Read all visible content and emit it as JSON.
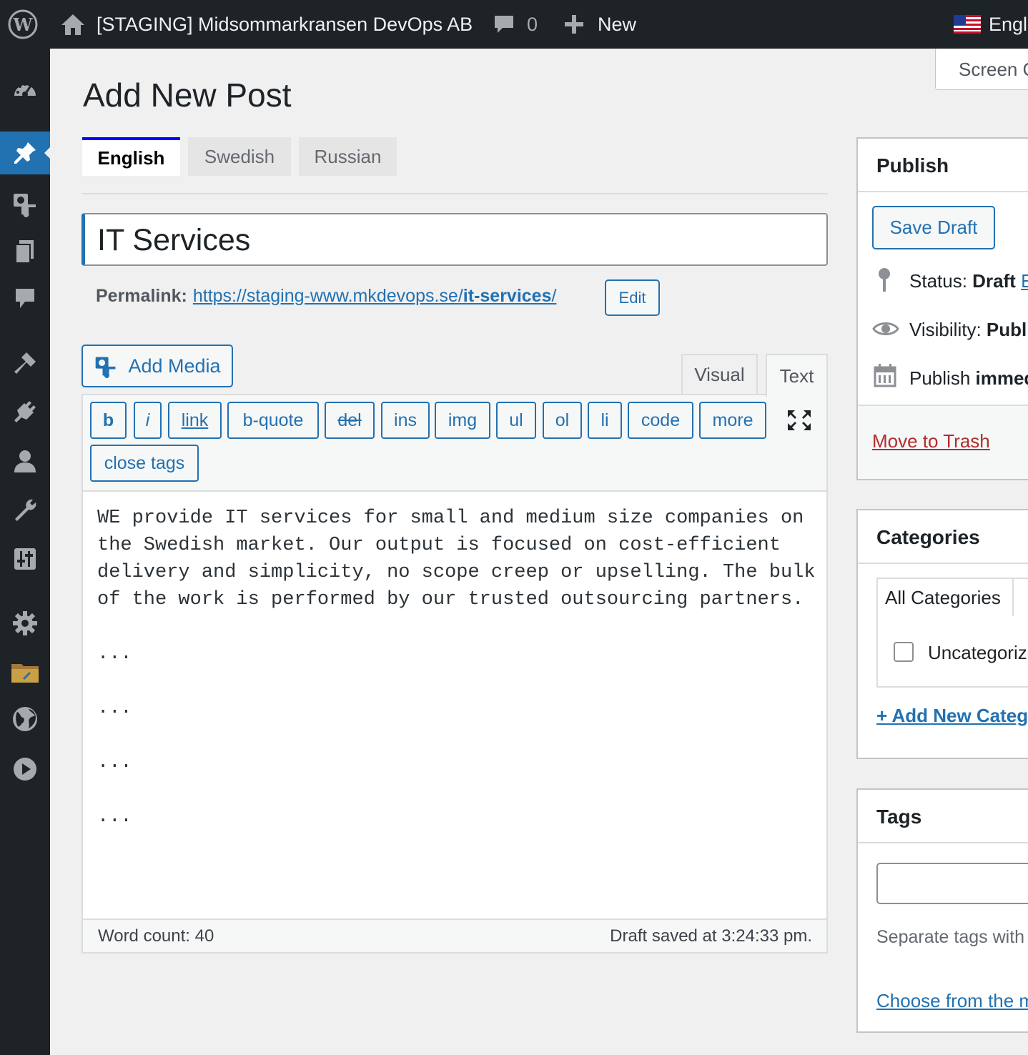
{
  "admin_bar": {
    "site_name": "[STAGING] Midsommarkransen DevOps AB",
    "comments_count": "0",
    "new_label": "New",
    "language_label": "English"
  },
  "screen_options_label": "Screen Options",
  "page_title": "Add New Post",
  "language_tabs": [
    "English",
    "Swedish",
    "Russian"
  ],
  "post": {
    "title": "IT Services",
    "permalink_label": "Permalink:",
    "permalink_base": "https://staging-www.mkdevops.se/",
    "permalink_slug": "it-services",
    "permalink_trailing": "/",
    "edit_label": "Edit"
  },
  "editor": {
    "add_media_label": "Add Media",
    "tab_visual": "Visual",
    "tab_text": "Text",
    "quicktags": [
      "b",
      "i",
      "link",
      "b-quote",
      "del",
      "ins",
      "img",
      "ul",
      "ol",
      "li",
      "code",
      "more",
      "close tags"
    ],
    "content": "WE provide IT services for small and medium size companies on\nthe Swedish market. Our output is focused on cost-efficient\ndelivery and simplicity, no scope creep or upselling. The bulk\nof the work is performed by our trusted outsourcing partners.\n\n...\n\n...\n\n...\n\n...",
    "word_count_label": "Word count: 40",
    "draft_saved": "Draft saved at 3:24:33 pm."
  },
  "publish_box": {
    "title": "Publish",
    "save_draft": "Save Draft",
    "status_label": "Status:",
    "status_value": "Draft",
    "status_edit": "Edit",
    "visibility_label": "Visibility:",
    "visibility_value": "Public",
    "publish_label": "Publish",
    "publish_value": "immediately",
    "move_to_trash": "Move to Trash"
  },
  "categories_box": {
    "title": "Categories",
    "tab_all": "All Categories",
    "item": "Uncategorized",
    "add_new": "+ Add New Category"
  },
  "tags_box": {
    "title": "Tags",
    "help": "Separate tags with commas",
    "choose": "Choose from the most used tags"
  },
  "colors": {
    "admin_bar_bg": "#1d2327",
    "accent": "#2271b1",
    "trash": "#b32d2e",
    "page_bg": "#f0f0f1"
  }
}
